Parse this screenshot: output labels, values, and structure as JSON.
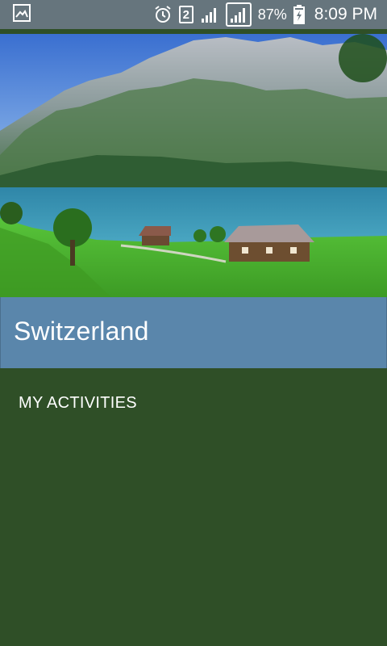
{
  "status_bar": {
    "battery_percent": "87%",
    "time": "8:09 PM",
    "sim_slot": "2",
    "icons": [
      "gallery-notification-icon",
      "alarm-icon",
      "sim-2-icon",
      "signal-icon",
      "signal-icon",
      "battery-charging-icon"
    ]
  },
  "hero": {
    "image_subject": "lake-and-mountains-photo"
  },
  "place": {
    "title": "Switzerland"
  },
  "menu": {
    "activities_label": "MY ACTIVITIES"
  },
  "colors": {
    "status_bar": "#66757d",
    "title_bar": "#5a86ab",
    "background": "#2f4f27"
  }
}
